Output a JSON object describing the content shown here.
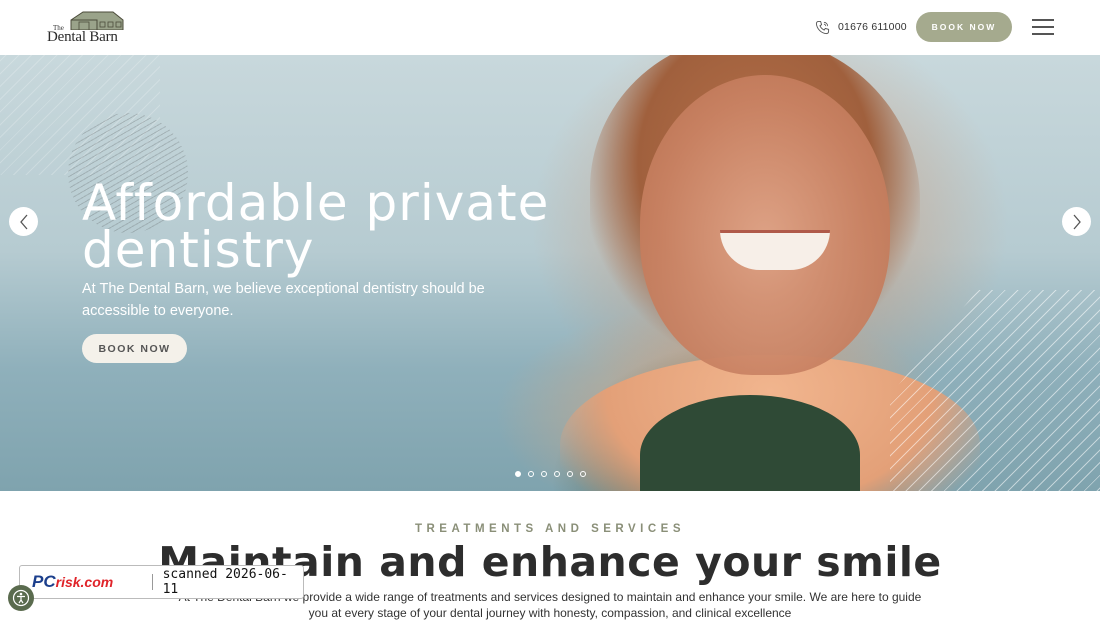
{
  "header": {
    "logo_the": "The",
    "logo_name": "Dental Barn",
    "phone_icon": "phone-icon",
    "phone": "01676 611000",
    "book_label": "BOOK NOW",
    "menu_icon": "hamburger-menu-icon"
  },
  "hero": {
    "title": "Affordable private dentistry",
    "subtitle": "At The Dental Barn, we believe exceptional dentistry should be accessible to everyone.",
    "button_label": "BOOK NOW",
    "prev_icon": "chevron-left-icon",
    "next_icon": "chevron-right-icon",
    "slides_count": 6,
    "active_slide": 1
  },
  "services": {
    "eyebrow": "TREATMENTS AND SERVICES",
    "title": "Maintain and enhance your smile",
    "text": "At The Dental Barn we provide a wide range of treatments and services designed to maintain and enhance your smile. We are here to guide you at every stage of your dental journey with honesty, compassion, and clinical excellence"
  },
  "overlay": {
    "brand_pc": "PC",
    "brand_risk": "risk.com",
    "scanned": "scanned 2026-06-11",
    "accessibility_icon": "accessibility-icon"
  },
  "colors": {
    "accent": "#a5aa8e",
    "eyebrow": "#8a8f78",
    "text_dark": "#2d2d2d"
  }
}
